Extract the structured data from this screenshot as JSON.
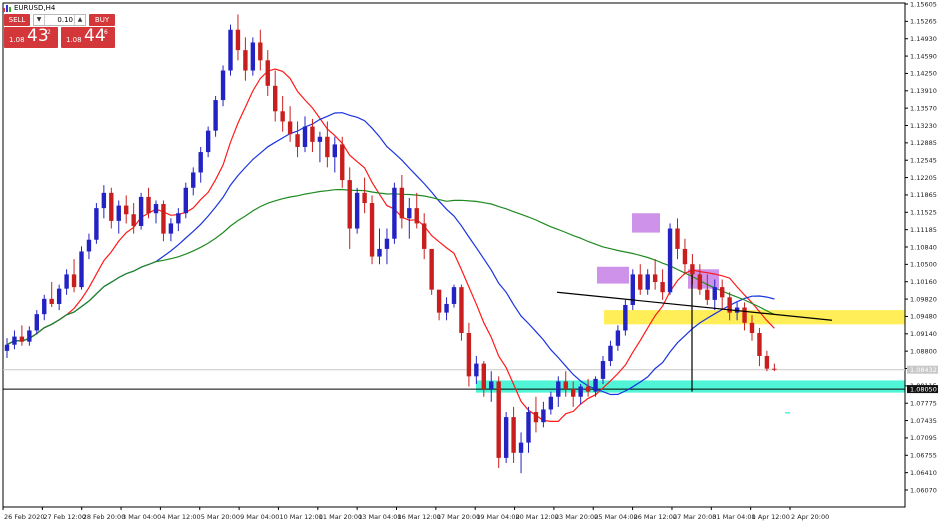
{
  "title": {
    "symbol": "EURUSD,H4"
  },
  "trade_panel": {
    "sell_label": "SELL",
    "buy_label": "BUY",
    "lot_value": "0.10",
    "lot_down_symbol": "▼",
    "lot_up_symbol": "▲",
    "sell_price_small": "1.08",
    "sell_price_big": "43",
    "sell_price_sup": "2",
    "buy_price_small": "1.08",
    "buy_price_big": "44",
    "buy_price_sup": "6"
  },
  "colors": {
    "bull": "#2323c4",
    "bear": "#c81e1e",
    "ma_fast": "#ff1a1a",
    "ma_mid": "#1a34e0",
    "ma_slow": "#1f8a1f",
    "purple_zone": "#c77fe8",
    "yellow_zone": "#ffee58",
    "cyan_zone": "#4ff5d6",
    "price_tag": "#5a5a5a"
  },
  "chart_data": {
    "type": "candlestick",
    "symbol": "EURUSD",
    "timeframe": "H4",
    "price_axis_labels": [
      "1.15605",
      "1.15265",
      "1.14930",
      "1.14590",
      "1.14250",
      "1.13910",
      "1.13570",
      "1.13230",
      "1.12885",
      "1.12545",
      "1.12205",
      "1.11865",
      "1.11525",
      "1.11185",
      "1.10840",
      "1.10500",
      "1.10160",
      "1.09820",
      "1.09480",
      "1.09140",
      "1.08800",
      "1.08455",
      "1.08115",
      "1.07775",
      "1.07435",
      "1.07095",
      "1.06755",
      "1.06410",
      "1.06070"
    ],
    "current_price_label": "1.08432",
    "horizontal_line_label": "1.08050",
    "x_axis_labels": [
      "26 Feb 2020",
      "27 Feb 12:00",
      "28 Feb 20:00",
      "3 Mar 04:00",
      "4 Mar 12:00",
      "5 Mar 20:00",
      "9 Mar 04:00",
      "10 Mar 12:00",
      "11 Mar 20:00",
      "13 Mar 04:00",
      "16 Mar 12:00",
      "17 Mar 20:00",
      "19 Mar 04:00",
      "20 Mar 12:00",
      "23 Mar 20:00",
      "25 Mar 04:00",
      "26 Mar 12:00",
      "27 Mar 20:00",
      "31 Mar 04:00",
      "1 Apr 12:00",
      "2 Apr 20:00"
    ],
    "price_range": [
      1.0607,
      1.15605
    ],
    "candles": [
      [
        1.088,
        1.0905,
        1.0866,
        1.0892
      ],
      [
        1.0892,
        1.092,
        1.0883,
        1.0908
      ],
      [
        1.0908,
        1.093,
        1.089,
        1.0898
      ],
      [
        1.0898,
        1.0928,
        1.089,
        1.092
      ],
      [
        1.092,
        1.096,
        1.0912,
        1.0952
      ],
      [
        1.0952,
        1.099,
        1.094,
        1.0982
      ],
      [
        1.0982,
        1.1015,
        1.0966,
        1.0972
      ],
      [
        1.0972,
        1.101,
        1.096,
        1.1002
      ],
      [
        1.1002,
        1.104,
        1.099,
        1.103
      ],
      [
        1.103,
        1.106,
        1.0995,
        1.1005
      ],
      [
        1.1005,
        1.1085,
        1.1,
        1.1075
      ],
      [
        1.1075,
        1.111,
        1.106,
        1.1098
      ],
      [
        1.1098,
        1.117,
        1.109,
        1.116
      ],
      [
        1.116,
        1.1205,
        1.114,
        1.119
      ],
      [
        1.119,
        1.12,
        1.112,
        1.1135
      ],
      [
        1.1135,
        1.1175,
        1.111,
        1.1165
      ],
      [
        1.1165,
        1.1185,
        1.113,
        1.1148
      ],
      [
        1.1148,
        1.117,
        1.111,
        1.1125
      ],
      [
        1.1125,
        1.119,
        1.1118,
        1.1182
      ],
      [
        1.1182,
        1.12,
        1.114,
        1.115
      ],
      [
        1.115,
        1.1175,
        1.113,
        1.1168
      ],
      [
        1.1168,
        1.1175,
        1.1095,
        1.111
      ],
      [
        1.111,
        1.114,
        1.1095,
        1.113
      ],
      [
        1.113,
        1.116,
        1.1115,
        1.115
      ],
      [
        1.115,
        1.121,
        1.114,
        1.12
      ],
      [
        1.12,
        1.124,
        1.1185,
        1.123
      ],
      [
        1.123,
        1.128,
        1.121,
        1.127
      ],
      [
        1.127,
        1.132,
        1.126,
        1.1312
      ],
      [
        1.1312,
        1.138,
        1.13,
        1.1372
      ],
      [
        1.1372,
        1.144,
        1.136,
        1.143
      ],
      [
        1.143,
        1.152,
        1.142,
        1.151
      ],
      [
        1.151,
        1.154,
        1.145,
        1.147
      ],
      [
        1.147,
        1.1495,
        1.141,
        1.143
      ],
      [
        1.143,
        1.1495,
        1.142,
        1.1485
      ],
      [
        1.1485,
        1.151,
        1.143,
        1.145
      ],
      [
        1.145,
        1.147,
        1.138,
        1.14
      ],
      [
        1.14,
        1.143,
        1.133,
        1.135
      ],
      [
        1.135,
        1.138,
        1.131,
        1.133
      ],
      [
        1.133,
        1.136,
        1.129,
        1.1305
      ],
      [
        1.1305,
        1.133,
        1.126,
        1.128
      ],
      [
        1.128,
        1.134,
        1.127,
        1.132
      ],
      [
        1.132,
        1.1335,
        1.127,
        1.129
      ],
      [
        1.129,
        1.131,
        1.125,
        1.13
      ],
      [
        1.13,
        1.133,
        1.124,
        1.126
      ],
      [
        1.126,
        1.13,
        1.123,
        1.1285
      ],
      [
        1.1285,
        1.13,
        1.12,
        1.1215
      ],
      [
        1.1215,
        1.124,
        1.108,
        1.112
      ],
      [
        1.112,
        1.12,
        1.111,
        1.119
      ],
      [
        1.119,
        1.122,
        1.115,
        1.117
      ],
      [
        1.117,
        1.1185,
        1.105,
        1.1065
      ],
      [
        1.1065,
        1.112,
        1.105,
        1.108
      ],
      [
        1.108,
        1.112,
        1.105,
        1.11
      ],
      [
        1.11,
        1.121,
        1.109,
        1.12
      ],
      [
        1.12,
        1.1225,
        1.112,
        1.114
      ],
      [
        1.114,
        1.118,
        1.11,
        1.116
      ],
      [
        1.116,
        1.119,
        1.112,
        1.113
      ],
      [
        1.113,
        1.115,
        1.106,
        1.108
      ],
      [
        1.108,
        1.1,
        1.099,
        1.1
      ],
      [
        1.1,
        1.1,
        1.094,
        1.0955
      ],
      [
        1.0955,
        1.0985,
        1.094,
        1.0972
      ],
      [
        1.0972,
        1.101,
        1.0965,
        1.1005
      ],
      [
        1.1005,
        1.101,
        1.09,
        1.0915
      ],
      [
        1.0915,
        1.0935,
        1.081,
        1.083
      ],
      [
        1.083,
        1.087,
        1.0815,
        1.0855
      ],
      [
        1.0855,
        1.086,
        1.079,
        1.0805
      ],
      [
        1.0805,
        1.084,
        1.078,
        1.082
      ],
      [
        1.082,
        1.083,
        1.065,
        1.067
      ],
      [
        1.067,
        1.076,
        1.066,
        1.075
      ],
      [
        1.075,
        1.077,
        1.066,
        1.068
      ],
      [
        1.068,
        1.072,
        1.064,
        1.07
      ],
      [
        1.07,
        1.077,
        1.068,
        1.076
      ],
      [
        1.076,
        1.079,
        1.072,
        1.074
      ],
      [
        1.074,
        1.078,
        1.073,
        1.0765
      ],
      [
        1.0765,
        1.08,
        1.0755,
        1.079
      ],
      [
        1.079,
        1.083,
        1.077,
        1.082
      ],
      [
        1.082,
        1.084,
        1.079,
        1.0805
      ],
      [
        1.0805,
        1.082,
        1.077,
        1.079
      ],
      [
        1.079,
        1.0815,
        1.0775,
        1.081
      ],
      [
        1.081,
        1.0825,
        1.079,
        1.08
      ],
      [
        1.08,
        1.083,
        1.079,
        1.0825
      ],
      [
        1.0825,
        1.087,
        1.0815,
        1.086
      ],
      [
        1.086,
        1.09,
        1.085,
        1.089
      ],
      [
        1.089,
        1.093,
        1.088,
        1.092
      ],
      [
        1.092,
        1.098,
        1.091,
        1.097
      ],
      [
        1.097,
        1.104,
        1.096,
        1.103
      ],
      [
        1.103,
        1.105,
        1.099,
        1.1
      ],
      [
        1.1,
        1.104,
        1.099,
        1.103
      ],
      [
        1.103,
        1.106,
        1.1,
        1.1015
      ],
      [
        1.1015,
        1.104,
        1.098,
        1.0995
      ],
      [
        1.0995,
        1.113,
        1.099,
        1.112
      ],
      [
        1.112,
        1.114,
        1.106,
        1.108
      ],
      [
        1.108,
        1.11,
        1.103,
        1.105
      ],
      [
        1.105,
        1.107,
        1.101,
        1.103
      ],
      [
        1.103,
        1.105,
        1.099,
        1.1
      ],
      [
        1.1,
        1.103,
        1.097,
        1.098
      ],
      [
        1.098,
        1.102,
        1.096,
        1.1005
      ],
      [
        1.1005,
        1.102,
        1.096,
        1.0985
      ],
      [
        1.0985,
        1.0995,
        1.094,
        1.0955
      ],
      [
        1.0955,
        1.0975,
        1.094,
        1.0965
      ],
      [
        1.0965,
        1.0975,
        1.092,
        1.0935
      ],
      [
        1.0935,
        1.095,
        1.09,
        1.0915
      ],
      [
        1.0915,
        1.0925,
        1.085,
        1.087
      ],
      [
        1.087,
        1.088,
        1.084,
        1.0845
      ],
      [
        1.0845,
        1.0855,
        1.084,
        1.0843
      ]
    ]
  }
}
